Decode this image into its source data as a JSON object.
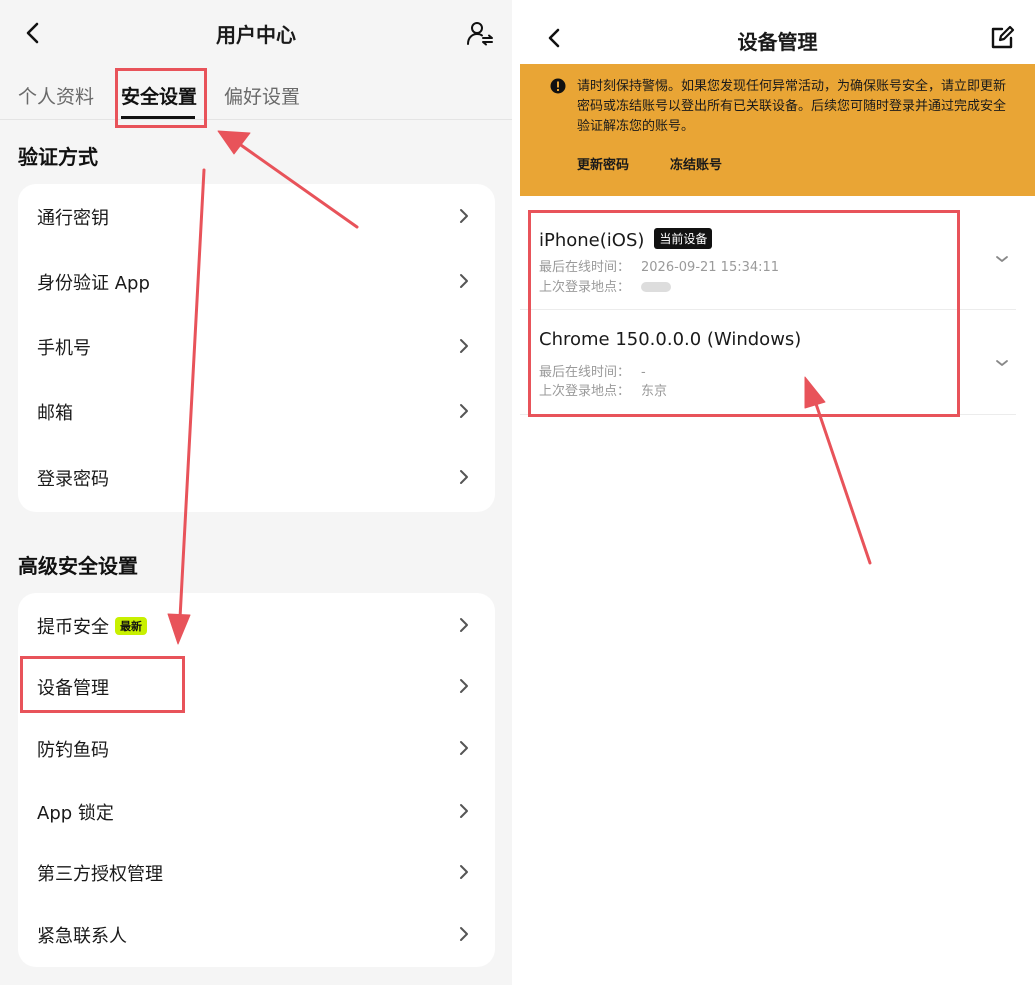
{
  "left_screen": {
    "title": "用户中心",
    "tabs": [
      {
        "label": "个人资料"
      },
      {
        "label": "安全设置"
      },
      {
        "label": "偏好设置"
      }
    ],
    "verification_section": {
      "title": "验证方式",
      "items": [
        {
          "label": "通行密钥"
        },
        {
          "label": "身份验证 App"
        },
        {
          "label": "手机号"
        },
        {
          "label": "邮箱"
        },
        {
          "label": "登录密码"
        }
      ]
    },
    "advanced_section": {
      "title": "高级安全设置",
      "items": [
        {
          "label": "提币安全",
          "badge": "最新"
        },
        {
          "label": "设备管理"
        },
        {
          "label": "防钓鱼码"
        },
        {
          "label": "App 锁定"
        },
        {
          "label": "第三方授权管理"
        },
        {
          "label": "紧急联系人"
        }
      ]
    }
  },
  "right_screen": {
    "title": "设备管理",
    "warning": {
      "text": "请时刻保持警惕。如果您发现任何异常活动，为确保账号安全，请立即更新密码或冻结账号以登出所有已关联设备。后续您可随时登录并通过完成安全验证解冻您的账号。",
      "update_password_label": "更新密码",
      "freeze_account_label": "冻结账号"
    },
    "devices": [
      {
        "name": "iPhone(iOS)",
        "badge": "当前设备",
        "last_online_label": "最后在线时间：",
        "last_online_value": "2026-09-21 15:34:11",
        "last_location_label": "上次登录地点：",
        "last_location_value": ""
      },
      {
        "name": "Chrome 150.0.0.0 (Windows)",
        "last_online_label": "最后在线时间：",
        "last_online_value": "-",
        "last_location_label": "上次登录地点：",
        "last_location_value": "东京"
      }
    ]
  },
  "colors": {
    "annotation_red": "#e8535a",
    "warning_bg": "#e9a535",
    "new_badge_bg": "#c8f000",
    "left_bg": "#f5f5f5"
  },
  "icons": [
    "back-icon",
    "user-swap-icon",
    "chevron-right-icon",
    "edit-icon",
    "exclamation-icon",
    "chevron-down-icon",
    "annotation-arrow"
  ]
}
